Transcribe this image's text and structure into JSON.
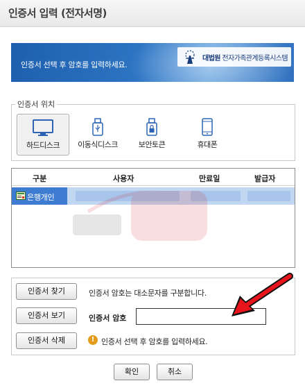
{
  "window": {
    "title": "인증서 입력 (전자서명)"
  },
  "banner": {
    "text": "인증서 선택 후 암호를 입력하세요.",
    "brand_strong": "대법원",
    "brand_rest": " 전자가족관계등록시스템"
  },
  "location": {
    "label": "인증서 위치",
    "items": [
      {
        "label": "하드디스크",
        "icon": "monitor-icon",
        "selected": true
      },
      {
        "label": "이동식디스크",
        "icon": "usb-icon",
        "selected": false
      },
      {
        "label": "보안토큰",
        "icon": "security-token-icon",
        "selected": false
      },
      {
        "label": "휴대폰",
        "icon": "mobile-phone-icon",
        "selected": false
      }
    ]
  },
  "cert_table": {
    "headers": [
      "구분",
      "사용자",
      "만료일",
      "발급자"
    ],
    "rows": [
      {
        "type": "은행개인"
      }
    ]
  },
  "actions": {
    "find_button": "인증서 찾기",
    "view_button": "인증서 보기",
    "delete_button": "인증서 삭제",
    "case_note": "인증서 암호는 대소문자를 구분합니다.",
    "password_label": "인증서 암호",
    "password_value": "",
    "warning": "인증서 선택 후 암호를 입력하세요."
  },
  "footer": {
    "ok_button": "확인",
    "cancel_button": "취소"
  },
  "colors": {
    "accent": "#3e7cd1",
    "banner": "#2d74c3",
    "warning": "#e59c1d",
    "arrow": "#e8141b"
  }
}
